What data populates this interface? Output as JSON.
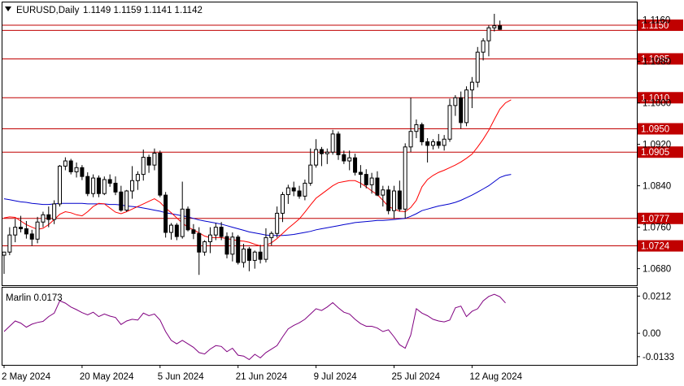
{
  "header": {
    "symbol_timeframe": "EURUSD,Daily",
    "ohlc": "1.1149 1.1159 1.1141 1.1142",
    "indicator_label": "Marlin 0.0173"
  },
  "chart_data": [
    {
      "type": "candlestick",
      "title": "EURUSD,Daily",
      "ylim": [
        1.0648,
        1.1194
      ],
      "y_ticks": [
        "1.1160",
        "1.1080",
        "1.1000",
        "1.0920",
        "1.0840",
        "1.0760",
        "1.0680"
      ],
      "x_labels": [
        "2 May 2024",
        "20 May 2024",
        "5 Jun 2024",
        "21 Jun 2024",
        "9 Jul 2024",
        "25 Jul 2024",
        "12 Aug 2024"
      ],
      "levels": [
        {
          "price": 1.115,
          "label": "1.1150",
          "color": "#c00000"
        },
        {
          "price": 1.114,
          "label": "1.1140",
          "color": "#c00000"
        },
        {
          "price": 1.1085,
          "label": "1.1085",
          "color": "#c00000"
        },
        {
          "price": 1.101,
          "label": "1.1010",
          "color": "#c00000"
        },
        {
          "price": 1.095,
          "label": "1.0950",
          "color": "#c00000"
        },
        {
          "price": 1.0905,
          "label": "1.0905",
          "color": "#c00000"
        },
        {
          "price": 1.0777,
          "label": "1.0777",
          "color": "#c00000"
        },
        {
          "price": 1.0724,
          "label": "1.0724",
          "color": "#c00000"
        }
      ],
      "candles": [
        [
          1.0706,
          1.0712,
          1.067,
          1.0712
        ],
        [
          1.0712,
          1.076,
          1.0706,
          1.0745
        ],
        [
          1.0745,
          1.0776,
          1.0731,
          1.076
        ],
        [
          1.076,
          1.0782,
          1.075,
          1.0757
        ],
        [
          1.0757,
          1.0772,
          1.0738,
          1.0747
        ],
        [
          1.0747,
          1.0755,
          1.0724,
          1.0737
        ],
        [
          1.0737,
          1.078,
          1.0729,
          1.077
        ],
        [
          1.077,
          1.079,
          1.076,
          1.0784
        ],
        [
          1.0784,
          1.08,
          1.076,
          1.0775
        ],
        [
          1.0775,
          1.0812,
          1.0766,
          1.0805
        ],
        [
          1.0805,
          1.088,
          1.08,
          1.0878
        ],
        [
          1.0878,
          1.0895,
          1.087,
          1.0888
        ],
        [
          1.0888,
          1.0892,
          1.0862,
          1.0867
        ],
        [
          1.0867,
          1.0885,
          1.0856,
          1.0875
        ],
        [
          1.0875,
          1.088,
          1.0851,
          1.0858
        ],
        [
          1.0858,
          1.0866,
          1.082,
          1.0825
        ],
        [
          1.0825,
          1.0862,
          1.0818,
          1.0855
        ],
        [
          1.0855,
          1.086,
          1.0818,
          1.0825
        ],
        [
          1.0825,
          1.0858,
          1.0822,
          1.0852
        ],
        [
          1.0852,
          1.0862,
          1.0838,
          1.0845
        ],
        [
          1.0845,
          1.0858,
          1.0822,
          1.0828
        ],
        [
          1.0828,
          1.084,
          1.079,
          1.0793
        ],
        [
          1.0793,
          1.0832,
          1.079,
          1.083
        ],
        [
          1.083,
          1.0878,
          1.0815,
          1.085
        ],
        [
          1.085,
          1.0868,
          1.0832,
          1.0862
        ],
        [
          1.0862,
          1.091,
          1.085,
          1.0895
        ],
        [
          1.0895,
          1.09,
          1.0865,
          1.088
        ],
        [
          1.088,
          1.0912,
          1.087,
          1.0903
        ],
        [
          1.0903,
          1.0908,
          1.0818,
          1.0822
        ],
        [
          1.0822,
          1.0828,
          1.074,
          1.075
        ],
        [
          1.075,
          1.0768,
          1.0736,
          1.0764
        ],
        [
          1.0764,
          1.0768,
          1.0735,
          1.0742
        ],
        [
          1.0742,
          1.0848,
          1.0738,
          1.0795
        ],
        [
          1.0795,
          1.08,
          1.0752,
          1.0755
        ],
        [
          1.0755,
          1.0766,
          1.0737,
          1.0748
        ],
        [
          1.0748,
          1.076,
          1.0668,
          1.0712
        ],
        [
          1.0712,
          1.0735,
          1.0705,
          1.0732
        ],
        [
          1.0732,
          1.076,
          1.071,
          1.0745
        ],
        [
          1.0745,
          1.0768,
          1.0735,
          1.076
        ],
        [
          1.076,
          1.077,
          1.0735,
          1.0742
        ],
        [
          1.0742,
          1.075,
          1.07,
          1.0708
        ],
        [
          1.0708,
          1.075,
          1.0694,
          1.0741
        ],
        [
          1.0741,
          1.0745,
          1.0688,
          1.0692
        ],
        [
          1.0692,
          1.0728,
          1.0682,
          1.0718
        ],
        [
          1.0718,
          1.0722,
          1.0675,
          1.0696
        ],
        [
          1.0696,
          1.0715,
          1.068,
          1.0712
        ],
        [
          1.0712,
          1.0726,
          1.069,
          1.0698
        ],
        [
          1.0698,
          1.0758,
          1.0692,
          1.074
        ],
        [
          1.074,
          1.0752,
          1.0725,
          1.0748
        ],
        [
          1.0748,
          1.08,
          1.074,
          1.0787
        ],
        [
          1.0787,
          1.0828,
          1.077,
          1.0823
        ],
        [
          1.0823,
          1.0842,
          1.0805,
          1.0836
        ],
        [
          1.0836,
          1.0848,
          1.082,
          1.083
        ],
        [
          1.083,
          1.084,
          1.0815,
          1.082
        ],
        [
          1.082,
          1.0852,
          1.0812,
          1.0845
        ],
        [
          1.0845,
          1.0912,
          1.084,
          1.088
        ],
        [
          1.088,
          1.093,
          1.0875,
          1.091
        ],
        [
          1.091,
          1.0915,
          1.0878,
          1.0902
        ],
        [
          1.0902,
          1.0912,
          1.0882,
          1.0905
        ],
        [
          1.0905,
          1.0948,
          1.09,
          1.094
        ],
        [
          1.094,
          1.0945,
          1.089,
          1.09
        ],
        [
          1.09,
          1.0908,
          1.0882,
          1.0888
        ],
        [
          1.0888,
          1.0908,
          1.087,
          1.0894
        ],
        [
          1.0894,
          1.0902,
          1.086,
          1.0866
        ],
        [
          1.0866,
          1.088,
          1.0836,
          1.0862
        ],
        [
          1.0862,
          1.0872,
          1.0835,
          1.0842
        ],
        [
          1.0842,
          1.0865,
          1.0825,
          1.0855
        ],
        [
          1.0855,
          1.0868,
          1.082,
          1.0822
        ],
        [
          1.0822,
          1.084,
          1.08,
          1.0832
        ],
        [
          1.0832,
          1.084,
          1.0785,
          1.0792
        ],
        [
          1.0792,
          1.084,
          1.0777,
          1.083
        ],
        [
          1.083,
          1.085,
          1.079,
          1.0795
        ],
        [
          1.0795,
          1.0922,
          1.0777,
          1.0915
        ],
        [
          1.0915,
          1.101,
          1.0905,
          1.0945
        ],
        [
          1.0945,
          1.0968,
          1.0932,
          1.0958
        ],
        [
          1.0958,
          1.0962,
          1.0918,
          1.0925
        ],
        [
          1.0925,
          1.0932,
          1.0885,
          1.0918
        ],
        [
          1.0918,
          1.093,
          1.091,
          1.0925
        ],
        [
          1.0925,
          1.094,
          1.0912,
          1.0918
        ],
        [
          1.0918,
          1.0938,
          1.0908,
          1.093
        ],
        [
          1.093,
          1.1008,
          1.0925,
          1.0995
        ],
        [
          1.0995,
          1.1015,
          1.0975,
          1.101
        ],
        [
          1.101,
          1.1022,
          1.095,
          1.0962
        ],
        [
          1.0962,
          1.1032,
          1.0955,
          1.1025
        ],
        [
          1.1025,
          1.105,
          1.099,
          1.104
        ],
        [
          1.104,
          1.1108,
          1.103,
          1.1098
        ],
        [
          1.1098,
          1.1125,
          1.1082,
          1.112
        ],
        [
          1.112,
          1.115,
          1.109,
          1.1145
        ],
        [
          1.1145,
          1.1172,
          1.1138,
          1.1149
        ],
        [
          1.1149,
          1.1159,
          1.1141,
          1.1142
        ]
      ],
      "ma_fast": [
        1.0778,
        1.078,
        1.0779,
        1.0772,
        1.0765,
        1.076,
        1.0756,
        1.0758,
        1.0765,
        1.0775,
        1.0785,
        1.079,
        1.0788,
        1.0784,
        1.0782,
        1.079,
        1.08,
        1.0806,
        1.0805,
        1.0797,
        1.0789,
        1.0786,
        1.079,
        1.0795,
        1.08,
        1.0805,
        1.081,
        1.0815,
        1.0808,
        1.0797,
        1.0788,
        1.0778,
        1.0768,
        1.076,
        1.0755,
        1.0749,
        1.0743,
        1.074,
        1.074,
        1.074,
        1.0738,
        1.0736,
        1.0734,
        1.0733,
        1.0731,
        1.0727,
        1.0724,
        1.0725,
        1.073,
        1.0738,
        1.0748,
        1.0758,
        1.0767,
        1.0776,
        1.0789,
        1.0803,
        1.0816,
        1.0824,
        1.0832,
        1.084,
        1.0846,
        1.0848,
        1.085,
        1.085,
        1.0845,
        1.0838,
        1.083,
        1.0823,
        1.0812,
        1.08,
        1.0795,
        1.0791,
        1.079,
        1.0798,
        1.0812,
        1.0838,
        1.0852,
        1.086,
        1.0866,
        1.087,
        1.0875,
        1.088,
        1.0886,
        1.0893,
        1.0901,
        1.0915,
        1.093,
        1.0947,
        1.0968,
        1.0988,
        1.1,
        1.1006
      ],
      "ma_slow": [
        1.0815,
        1.0813,
        1.0811,
        1.0809,
        1.0808,
        1.0806,
        1.0805,
        1.0804,
        1.0804,
        1.0805,
        1.0806,
        1.0806,
        1.0806,
        1.0806,
        1.0806,
        1.0805,
        1.0805,
        1.0805,
        1.0805,
        1.0804,
        1.0804,
        1.0803,
        1.0801,
        1.08,
        1.0799,
        1.0797,
        1.0795,
        1.0793,
        1.0791,
        1.0788,
        1.0786,
        1.0784,
        1.0782,
        1.078,
        1.0777,
        1.0774,
        1.0772,
        1.077,
        1.0768,
        1.0766,
        1.0763,
        1.076,
        1.0757,
        1.0754,
        1.0751,
        1.0749,
        1.0747,
        1.0745,
        1.0744,
        1.0744,
        1.0744,
        1.0745,
        1.0746,
        1.0748,
        1.075,
        1.0752,
        1.0755,
        1.0757,
        1.0759,
        1.0761,
        1.0763,
        1.0765,
        1.0767,
        1.0769,
        1.077,
        1.0771,
        1.0772,
        1.0773,
        1.0773,
        1.0774,
        1.0775,
        1.0776,
        1.0777,
        1.0781,
        1.0786,
        1.0792,
        1.0795,
        1.0798,
        1.0801,
        1.0803,
        1.0805,
        1.0808,
        1.0812,
        1.0817,
        1.0822,
        1.0828,
        1.0834,
        1.084,
        1.0848,
        1.0856,
        1.086,
        1.0862
      ],
      "fast_color": "#ff0000",
      "slow_color": "#0000cc"
    },
    {
      "type": "line",
      "title": "Marlin 0.0173",
      "ylim": [
        -0.018,
        0.026
      ],
      "y_ticks": [
        "0.0212",
        "0.00",
        "-0.0133"
      ],
      "color": "#800080",
      "values": [
        0.001,
        0.004,
        0.007,
        0.0058,
        0.0035,
        0.0052,
        0.0062,
        0.0068,
        0.0095,
        0.0115,
        0.0185,
        0.0172,
        0.015,
        0.0135,
        0.0118,
        0.0105,
        0.012,
        0.0095,
        0.011,
        0.0098,
        0.009,
        0.005,
        0.007,
        0.008,
        0.0075,
        0.0115,
        0.01,
        0.011,
        0.0075,
        0.001,
        -0.004,
        -0.006,
        -0.004,
        -0.006,
        -0.008,
        -0.011,
        -0.0118,
        -0.009,
        -0.007,
        -0.0075,
        -0.0105,
        -0.0085,
        -0.0125,
        -0.013,
        -0.015,
        -0.012,
        -0.014,
        -0.011,
        -0.009,
        -0.007,
        -0.002,
        0.0025,
        0.0045,
        0.006,
        0.008,
        0.011,
        0.014,
        0.013,
        0.015,
        0.0175,
        0.0145,
        0.012,
        0.011,
        0.008,
        0.0055,
        0.004,
        0.004,
        0.003,
        0.001,
        0.002,
        -0.002,
        -0.0065,
        -0.0085,
        -0.001,
        0.014,
        0.0115,
        0.01,
        0.008,
        0.007,
        0.0065,
        0.0075,
        0.0145,
        0.0155,
        0.0095,
        0.0125,
        0.014,
        0.0185,
        0.021,
        0.0222,
        0.0208,
        0.0173
      ]
    }
  ]
}
